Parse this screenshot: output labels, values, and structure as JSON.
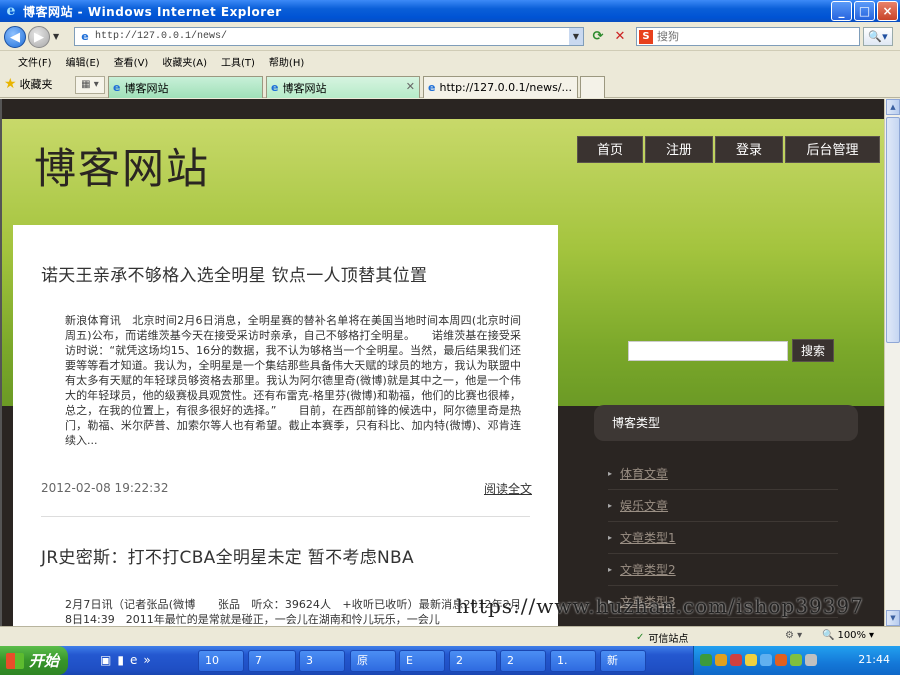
{
  "window": {
    "title": "博客网站 - Windows Internet Explorer",
    "controls": {
      "minimize": "_",
      "maximize": "□",
      "close": "×"
    }
  },
  "address": {
    "url": "http://127.0.0.1/news/",
    "search_placeholder": "搜狗"
  },
  "menu": [
    "文件(F)",
    "编辑(E)",
    "查看(V)",
    "收藏夹(A)",
    "工具(T)",
    "帮助(H)"
  ],
  "favorites_label": "收藏夹",
  "tabs": [
    {
      "label": "博客网站"
    },
    {
      "label": "博客网站"
    },
    {
      "label": "http://127.0.0.1/news/..."
    }
  ],
  "site": {
    "title": "博客网站",
    "nav": [
      "首页",
      "注册",
      "登录",
      "后台管理"
    ],
    "search_button": "搜索",
    "category_heading": "博客类型",
    "categories": [
      "体育文章",
      "娱乐文章",
      "文章类型1",
      "文章类型2",
      "文章类型3"
    ]
  },
  "posts": [
    {
      "title": "诺天王亲承不够格入选全明星 钦点一人顶替其位置",
      "body": "新浪体育讯　北京时间2月6日消息，全明星赛的替补名单将在美国当地时间本周四(北京时间周五)公布，而诺维茨基今天在接受采访时亲承，自己不够格打全明星。　　诺维茨基在接受采访时说：“就凭这场均15、16分的数据，我不认为够格当一个全明星。当然，最后结果我们还要等等看才知道。我认为，全明星是一个集结那些具备伟大天赋的球员的地方，我认为联盟中有太多有天赋的年轻球员够资格去那里。我认为阿尔德里奇(微博)就是其中之一，他是一个伟大的年轻球员，他的级赛极具观赏性。还有布雷克-格里芬(微博)和勒福，他们的比赛也很棒，总之，在我的位置上，有很多很好的选择。”　　目前，在西部前锋的候选中，阿尔德里奇是热门，勒福、米尔萨普、加索尔等人也有希望。截止本赛季，只有科比、加内特(微博)、邓肯连续入...",
      "date": "2012-02-08 19:22:32",
      "read_more": "阅读全文"
    },
    {
      "title": "JR史密斯：打不打CBA全明星未定 暂不考虑NBA",
      "body": "2月7日讯（记者张品(微博　　张品　听众：39624人　+收听已收听）最新消息2012年2月8日14:39　2011年最忙的是常就是碰正，一会儿在湖南和怜儿玩乐，一会儿"
    }
  ],
  "watermark": "https://www.huzhan.com/ishop39397",
  "status": {
    "zone": "可信站点",
    "zoom": "100%"
  },
  "taskbar": {
    "start": "开始",
    "items": [
      "10",
      "7",
      "3",
      "原",
      "E",
      "2",
      "2",
      "1.",
      "新"
    ],
    "clock": "21:44"
  }
}
